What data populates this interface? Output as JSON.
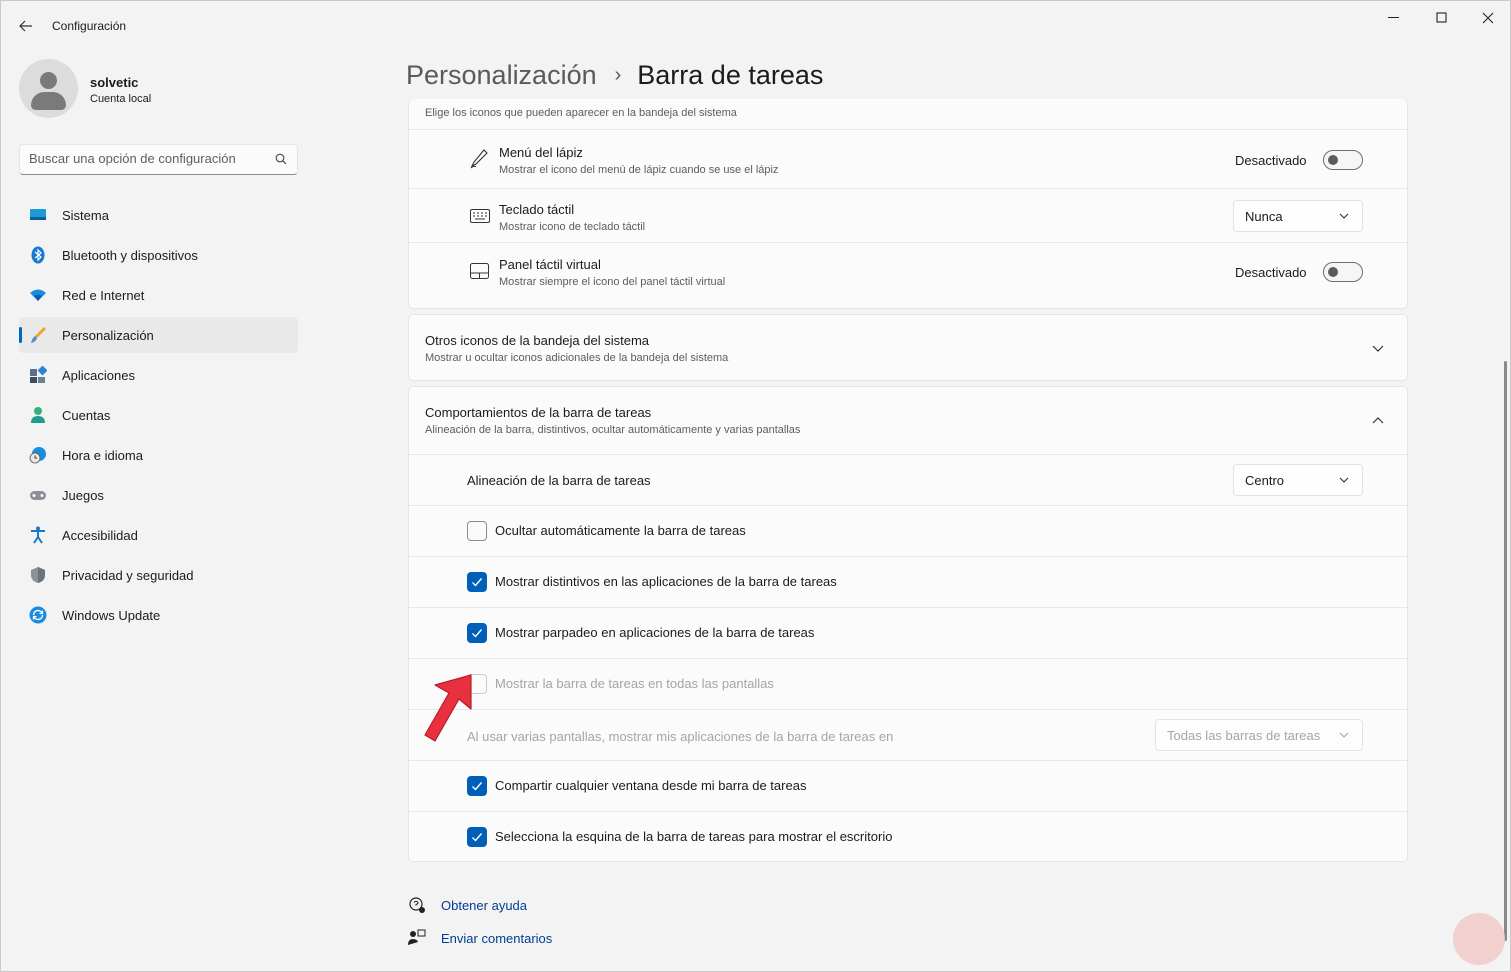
{
  "window": {
    "title": "Configuración"
  },
  "profile": {
    "name": "solvetic",
    "account_type": "Cuenta local"
  },
  "search": {
    "placeholder": "Buscar una opción de configuración"
  },
  "nav": {
    "items": [
      {
        "label": "Sistema",
        "icon": "monitor-icon"
      },
      {
        "label": "Bluetooth y dispositivos",
        "icon": "bluetooth-icon"
      },
      {
        "label": "Red e Internet",
        "icon": "wifi-icon"
      },
      {
        "label": "Personalización",
        "icon": "brush-icon",
        "active": true
      },
      {
        "label": "Aplicaciones",
        "icon": "apps-icon"
      },
      {
        "label": "Cuentas",
        "icon": "person-icon"
      },
      {
        "label": "Hora e idioma",
        "icon": "globe-clock-icon"
      },
      {
        "label": "Juegos",
        "icon": "gamepad-icon"
      },
      {
        "label": "Accesibilidad",
        "icon": "accessibility-icon"
      },
      {
        "label": "Privacidad y seguridad",
        "icon": "shield-icon"
      },
      {
        "label": "Windows Update",
        "icon": "update-icon"
      }
    ]
  },
  "breadcrumb": {
    "parent": "Personalización",
    "separator": "›",
    "current": "Barra de tareas"
  },
  "tray_icons": {
    "header_sub": "Elige los iconos que pueden aparecer en la bandeja del sistema",
    "pen_menu": {
      "title": "Menú del lápiz",
      "sub": "Mostrar el icono del menú de lápiz cuando se use el lápiz",
      "state": "Desactivado"
    },
    "touch_keyboard": {
      "title": "Teclado táctil",
      "sub": "Mostrar icono de teclado táctil",
      "value": "Nunca"
    },
    "virtual_touchpad": {
      "title": "Panel táctil virtual",
      "sub": "Mostrar siempre el icono del panel táctil virtual",
      "state": "Desactivado"
    }
  },
  "other_tray": {
    "title": "Otros iconos de la bandeja del sistema",
    "sub": "Mostrar u ocultar iconos adicionales de la bandeja del sistema"
  },
  "behaviors": {
    "title": "Comportamientos de la barra de tareas",
    "sub": "Alineación de la barra, distintivos, ocultar automáticamente y varias pantallas",
    "alignment": {
      "label": "Alineación de la barra de tareas",
      "value": "Centro"
    },
    "auto_hide": {
      "label": "Ocultar automáticamente la barra de tareas",
      "checked": false
    },
    "badges": {
      "label": "Mostrar distintivos en las aplicaciones de la barra de tareas",
      "checked": true
    },
    "flashing": {
      "label": "Mostrar parpadeo en aplicaciones de la barra de tareas",
      "checked": true
    },
    "all_displays": {
      "label": "Mostrar la barra de tareas en todas las pantallas",
      "checked": false,
      "disabled": true
    },
    "multi_display": {
      "label": "Al usar varias pantallas, mostrar mis aplicaciones de la barra de tareas en",
      "value": "Todas las barras de tareas",
      "disabled": true
    },
    "share_window": {
      "label": "Compartir cualquier ventana desde mi barra de tareas",
      "checked": true
    },
    "far_corner": {
      "label": "Selecciona la esquina de la barra de tareas para mostrar el escritorio",
      "checked": true
    }
  },
  "footer": {
    "help": "Obtener ayuda",
    "feedback": "Enviar comentarios"
  },
  "colors": {
    "accent": "#005fb8",
    "annotation_arrow": "#e8303f"
  }
}
